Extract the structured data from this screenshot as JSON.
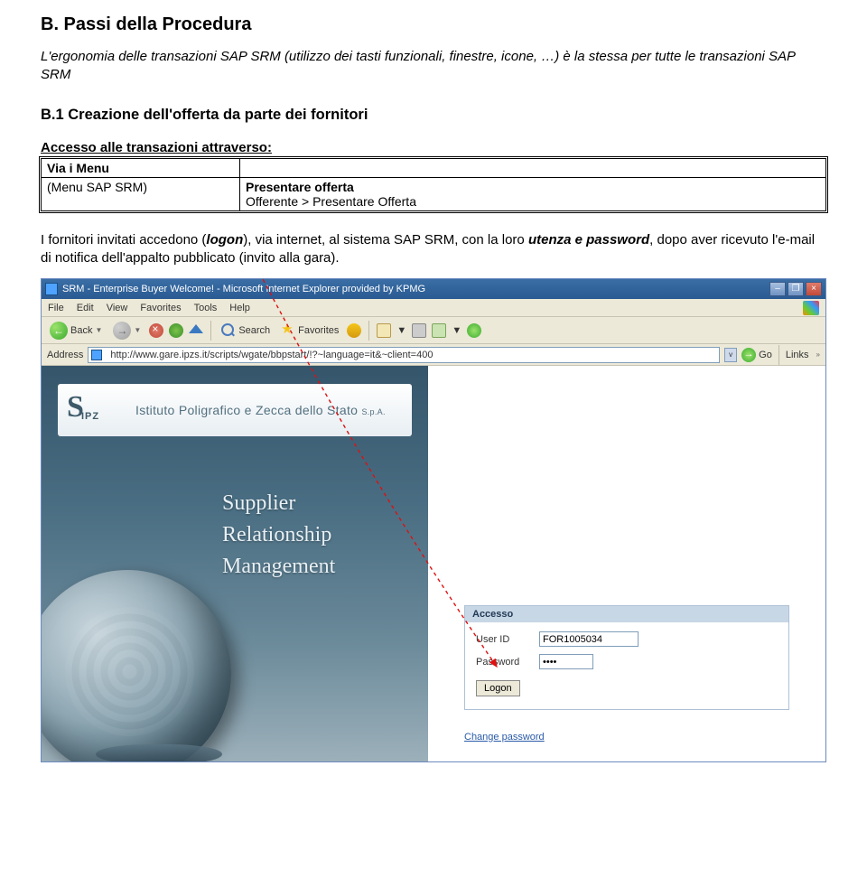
{
  "title": "B. Passi della Procedura",
  "intro": "L'ergonomia delle transazioni SAP SRM (utilizzo dei tasti funzionali, finestre, icone, …) è la stessa per tutte le transazioni SAP SRM",
  "sub_heading": "B.1    Creazione dell'offerta da parte dei fornitori",
  "access_label": "Accesso alle transazioni attraverso:",
  "table": {
    "r1c1": "Via i Menu",
    "r2c1": "(Menu SAP SRM)",
    "r2c2_line1": "Presentare offerta",
    "r2c2_line2": "Offerente > Presentare Offerta"
  },
  "desc_parts": {
    "p1": "I fornitori invitati accedono (",
    "logon": "logon",
    "p2": "), via internet, al sistema SAP SRM, con la loro ",
    "utenza": "utenza e password",
    "p3": ", dopo aver ricevuto l'e-mail di notifica dell'appalto pubblicato (invito alla gara)."
  },
  "ie": {
    "title": "SRM - Enterprise Buyer Welcome!  -  Microsoft Internet Explorer provided by KPMG",
    "menu": [
      "File",
      "Edit",
      "View",
      "Favorites",
      "Tools",
      "Help"
    ],
    "back": "Back",
    "search": "Search",
    "favorites": "Favorites",
    "address_label": "Address",
    "url": "http://www.gare.ipzs.it/scripts/wgate/bbpstart/!?~language=it&~client=400",
    "go": "Go",
    "links": "Links"
  },
  "banner": {
    "org": "Istituto Poligrafico e Zecca dello Stato",
    "spa": "S.p.A."
  },
  "srm_lines": [
    "Supplier",
    "Relationship",
    "Management"
  ],
  "login": {
    "header": "Accesso",
    "userid_label": "User ID",
    "userid_value": "FOR1005034",
    "password_label": "Password",
    "password_value": "••••",
    "logon_btn": "Logon",
    "change_pw": "Change password"
  }
}
